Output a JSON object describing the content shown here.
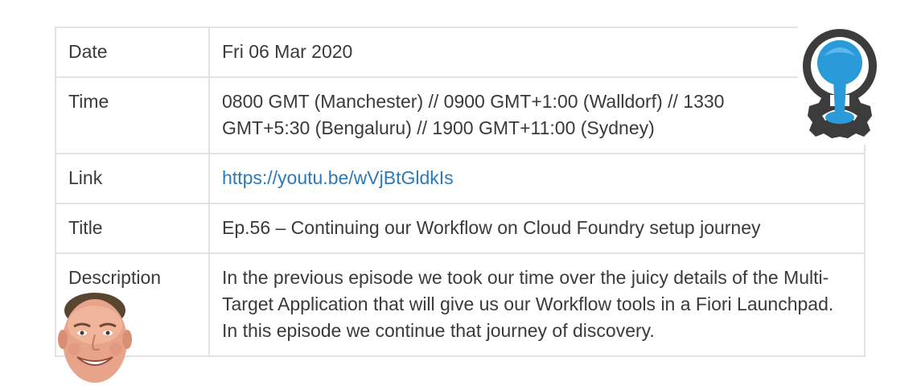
{
  "rows": [
    {
      "label": "Date",
      "value": "Fri 06 Mar 2020"
    },
    {
      "label": "Time",
      "value": "0800 GMT (Manchester) // 0900 GMT+1:00 (Walldorf) // 1330 GMT+5:30 (Bengaluru) // 1900 GMT+11:00 (Sydney)"
    },
    {
      "label": "Link",
      "value": "https://youtu.be/wVjBtGldkIs"
    },
    {
      "label": "Title",
      "value": "Ep.56 – Continuing our Workflow on Cloud Foundry setup journey"
    },
    {
      "label": "Description",
      "value": "In the previous episode we took our time over the juicy details of the Multi-Target Application that will give us our Workflow tools in a Fiori Launchpad. In this episode we continue that journey of discovery."
    }
  ],
  "colors": {
    "link": "#2d7ab8",
    "border": "#e2e2e2",
    "text": "#3a3a3a",
    "logo_dark": "#3c3c3c",
    "logo_blue": "#2a9ad8"
  },
  "icons": {
    "logo": "workflow-gear-icon",
    "avatar": "presenter-face-avatar"
  }
}
